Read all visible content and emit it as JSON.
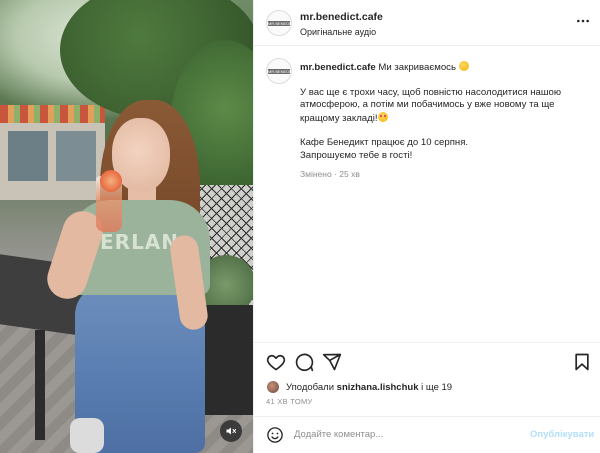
{
  "media": {
    "shirt_print": "ERLAN",
    "mute_icon": "speaker-muted-icon"
  },
  "header": {
    "username": "mr.benedict.cafe",
    "audio_label": "Оригінальне аудіо",
    "avatar_logo": "MR.BENEDICT",
    "more_icon": "more-horizontal-icon"
  },
  "caption": {
    "username": "mr.benedict.cafe",
    "title": "Ми закриваємось",
    "line1": "У вас ще є трохи часу, щоб повністю насолодитися нашою атмосферою, а потім ми побачимось у вже новому та ще кращому закладі!",
    "line2": "Кафе Бенедикт працює до 10 серпня.",
    "line3": "Запрошуємо тебе в гості!",
    "edited": "Змінено · 25 хв"
  },
  "actions": {
    "like_icon": "heart-icon",
    "comment_icon": "comment-icon",
    "share_icon": "share-icon",
    "save_icon": "bookmark-icon"
  },
  "likes": {
    "prefix": "Уподобали",
    "user": "snizhana.lishchuk",
    "suffix": "і ще 19"
  },
  "timestamp": "41 ХВ ТОМУ",
  "comment_box": {
    "placeholder": "Додайте коментар...",
    "post_label": "Опублікувати",
    "emoji_icon": "emoji-icon"
  },
  "colors": {
    "text": "#262626",
    "secondary": "#8e8e8e",
    "post_disabled": "#b2dffc",
    "divider": "#efefef"
  }
}
